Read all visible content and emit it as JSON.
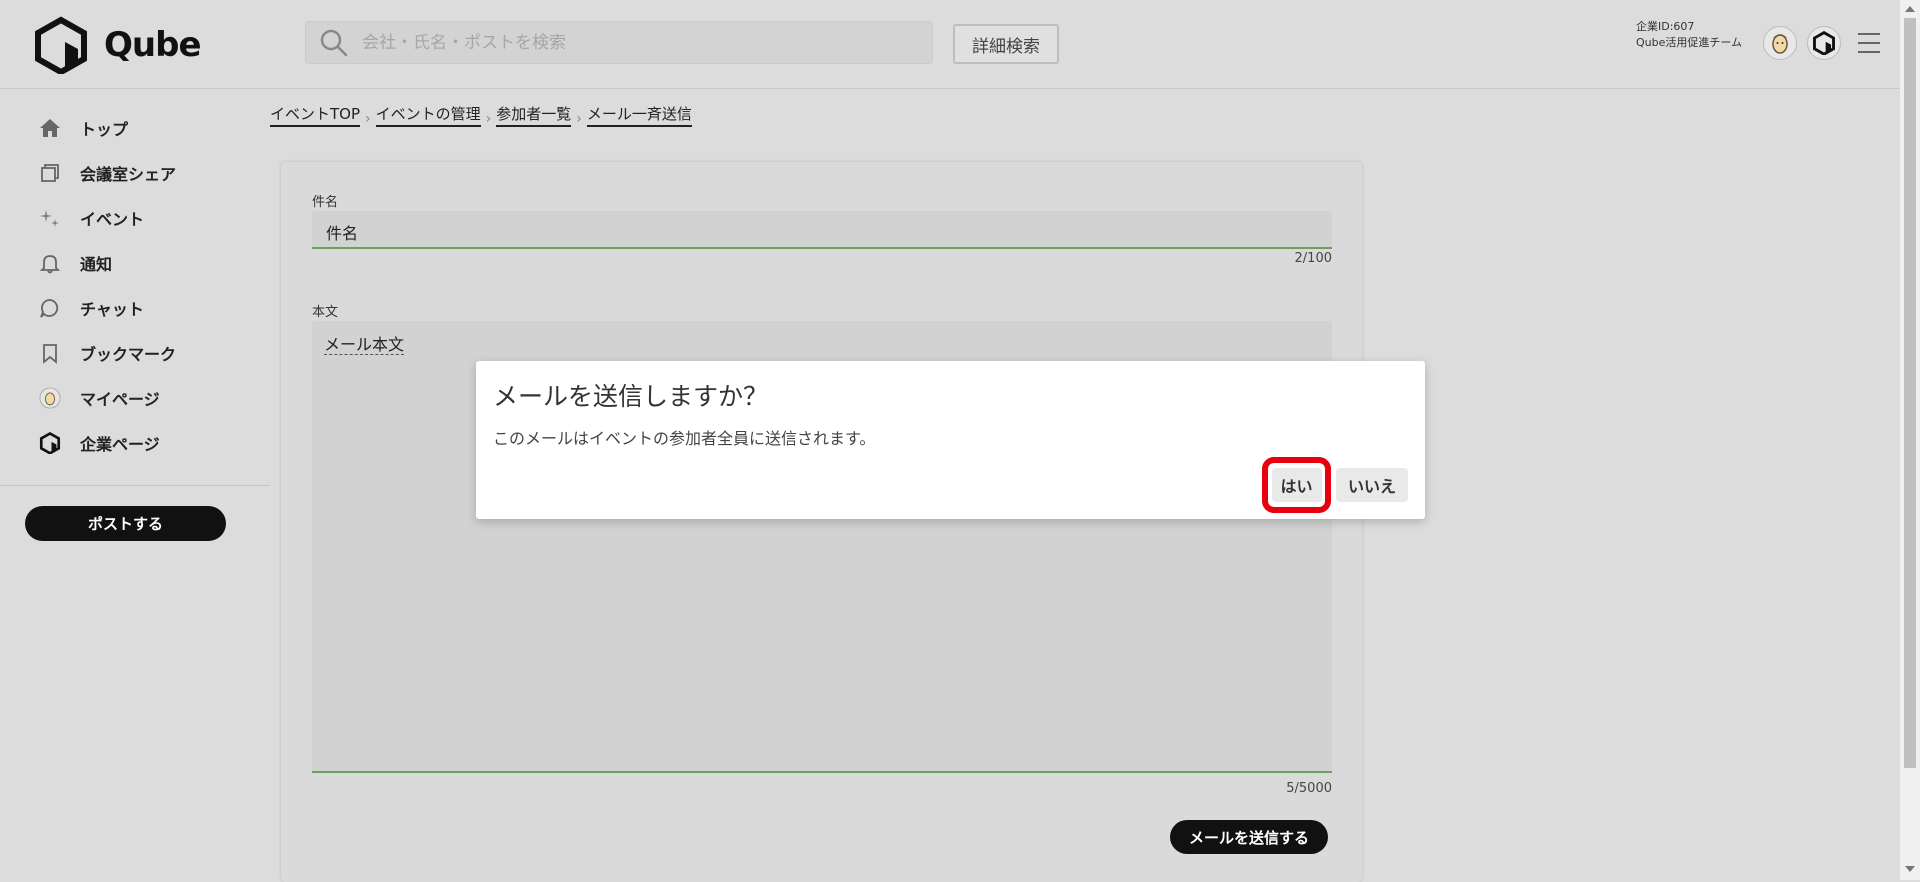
{
  "header": {
    "logo_text": "Qube",
    "search_placeholder": "会社・氏名・ポストを検索",
    "advanced_search_label": "詳細検索",
    "company_id": "企業ID:607",
    "company_team": "Qube活用促進チーム"
  },
  "sidebar": {
    "items": [
      {
        "label": "トップ",
        "icon": "home-icon"
      },
      {
        "label": "会議室シェア",
        "icon": "room-icon"
      },
      {
        "label": "イベント",
        "icon": "sparkle-icon"
      },
      {
        "label": "通知",
        "icon": "bell-icon"
      },
      {
        "label": "チャット",
        "icon": "chat-icon"
      },
      {
        "label": "ブックマーク",
        "icon": "bookmark-icon"
      },
      {
        "label": "マイページ",
        "icon": "avatar-icon"
      },
      {
        "label": "企業ページ",
        "icon": "company-logo-icon"
      }
    ],
    "post_label": "ポストする"
  },
  "breadcrumb": [
    "イベントTOP",
    "イベントの管理",
    "参加者一覧",
    "メール一斉送信"
  ],
  "form": {
    "subject_label": "件名",
    "subject_value": "件名",
    "subject_counter": "2/100",
    "body_label": "本文",
    "body_value": "メール本文",
    "body_counter": "5/5000",
    "send_label": "メールを送信する"
  },
  "dialog": {
    "title": "メールを送信しますか？",
    "message": "このメールはイベントの参加者全員に送信されます。",
    "yes_label": "はい",
    "no_label": "いいえ"
  },
  "colors": {
    "highlight": "#e8000f",
    "field_underline": "#6aa15a",
    "primary_button": "#111111"
  }
}
